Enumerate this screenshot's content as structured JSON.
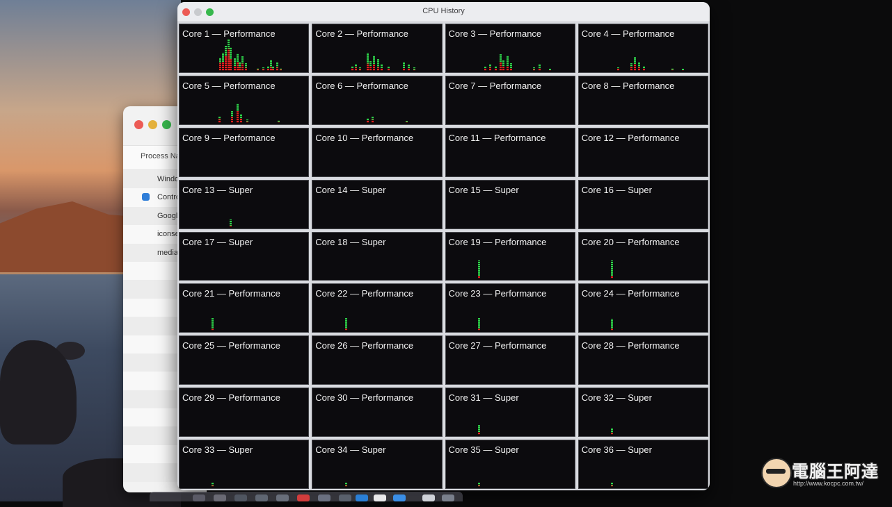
{
  "cpu_window": {
    "title": "CPU History",
    "cores": [
      {
        "label": "Core 1 — Performance",
        "bars": [
          {
            "x": 0.31,
            "h": 0.4,
            "r": 0.6
          },
          {
            "x": 0.33,
            "h": 0.55,
            "r": 0.5
          },
          {
            "x": 0.35,
            "h": 0.75,
            "r": 0.6
          },
          {
            "x": 0.37,
            "h": 0.95,
            "r": 0.7
          },
          {
            "x": 0.39,
            "h": 0.7,
            "r": 0.5
          },
          {
            "x": 0.42,
            "h": 0.38,
            "r": 0.4
          },
          {
            "x": 0.44,
            "h": 0.52,
            "r": 0.5
          },
          {
            "x": 0.46,
            "h": 0.28,
            "r": 0.4
          },
          {
            "x": 0.48,
            "h": 0.44,
            "r": 0.5
          },
          {
            "x": 0.51,
            "h": 0.22,
            "r": 0.4
          },
          {
            "x": 0.6,
            "h": 0.08,
            "r": 0.5
          },
          {
            "x": 0.64,
            "h": 0.1,
            "r": 0.5
          },
          {
            "x": 0.68,
            "h": 0.14,
            "r": 0.4
          },
          {
            "x": 0.7,
            "h": 0.33,
            "r": 0.3
          },
          {
            "x": 0.72,
            "h": 0.12,
            "r": 0.4
          },
          {
            "x": 0.75,
            "h": 0.24,
            "r": 0.4
          },
          {
            "x": 0.78,
            "h": 0.08,
            "r": 0.5
          }
        ]
      },
      {
        "label": "Core 2 — Performance",
        "bars": [
          {
            "x": 0.3,
            "h": 0.14,
            "r": 0.6
          },
          {
            "x": 0.33,
            "h": 0.2,
            "r": 0.5
          },
          {
            "x": 0.36,
            "h": 0.1,
            "r": 0.5
          },
          {
            "x": 0.42,
            "h": 0.55,
            "r": 0.4
          },
          {
            "x": 0.44,
            "h": 0.3,
            "r": 0.5
          },
          {
            "x": 0.47,
            "h": 0.45,
            "r": 0.4
          },
          {
            "x": 0.5,
            "h": 0.35,
            "r": 0.3
          },
          {
            "x": 0.53,
            "h": 0.2,
            "r": 0.4
          },
          {
            "x": 0.58,
            "h": 0.12,
            "r": 0.5
          },
          {
            "x": 0.7,
            "h": 0.25,
            "r": 0.3
          },
          {
            "x": 0.74,
            "h": 0.18,
            "r": 0.4
          },
          {
            "x": 0.78,
            "h": 0.1,
            "r": 0.3
          }
        ]
      },
      {
        "label": "Core 3 — Performance",
        "bars": [
          {
            "x": 0.3,
            "h": 0.12,
            "r": 0.6
          },
          {
            "x": 0.34,
            "h": 0.2,
            "r": 0.5
          },
          {
            "x": 0.38,
            "h": 0.15,
            "r": 0.5
          },
          {
            "x": 0.42,
            "h": 0.5,
            "r": 0.5
          },
          {
            "x": 0.44,
            "h": 0.32,
            "r": 0.4
          },
          {
            "x": 0.47,
            "h": 0.45,
            "r": 0.3
          },
          {
            "x": 0.5,
            "h": 0.22,
            "r": 0.3
          },
          {
            "x": 0.68,
            "h": 0.1,
            "r": 0.4
          },
          {
            "x": 0.72,
            "h": 0.2,
            "r": 0.3
          },
          {
            "x": 0.8,
            "h": 0.06,
            "r": 0.3
          }
        ]
      },
      {
        "label": "Core 4 — Performance",
        "bars": [
          {
            "x": 0.3,
            "h": 0.1,
            "r": 0.6
          },
          {
            "x": 0.4,
            "h": 0.22,
            "r": 0.5
          },
          {
            "x": 0.43,
            "h": 0.42,
            "r": 0.5
          },
          {
            "x": 0.46,
            "h": 0.26,
            "r": 0.4
          },
          {
            "x": 0.5,
            "h": 0.14,
            "r": 0.4
          },
          {
            "x": 0.72,
            "h": 0.08,
            "r": 0.4
          },
          {
            "x": 0.8,
            "h": 0.06,
            "r": 0.3
          }
        ]
      },
      {
        "label": "Core 5 — Performance",
        "bars": [
          {
            "x": 0.3,
            "h": 0.18,
            "r": 0.6
          },
          {
            "x": 0.4,
            "h": 0.35,
            "r": 0.5
          },
          {
            "x": 0.44,
            "h": 0.58,
            "r": 0.6
          },
          {
            "x": 0.47,
            "h": 0.28,
            "r": 0.5
          },
          {
            "x": 0.52,
            "h": 0.1,
            "r": 0.4
          },
          {
            "x": 0.76,
            "h": 0.08,
            "r": 0.4
          }
        ]
      },
      {
        "label": "Core 6 — Performance",
        "bars": [
          {
            "x": 0.42,
            "h": 0.14,
            "r": 0.5
          },
          {
            "x": 0.46,
            "h": 0.18,
            "r": 0.5
          },
          {
            "x": 0.72,
            "h": 0.06,
            "r": 0.5
          }
        ]
      },
      {
        "label": "Core 7 — Performance",
        "bars": []
      },
      {
        "label": "Core 8 — Performance",
        "bars": []
      },
      {
        "label": "Core 9 — Performance",
        "bars": []
      },
      {
        "label": "Core 10 — Performance",
        "bars": []
      },
      {
        "label": "Core 11 — Performance",
        "bars": []
      },
      {
        "label": "Core 12 — Performance",
        "bars": []
      },
      {
        "label": "Core 13 — Super",
        "bars": [
          {
            "x": 0.39,
            "h": 0.22,
            "r": 0.2
          }
        ]
      },
      {
        "label": "Core 14 — Super",
        "bars": []
      },
      {
        "label": "Core 15 — Super",
        "bars": []
      },
      {
        "label": "Core 16 — Super",
        "bars": []
      },
      {
        "label": "Core 17 — Super",
        "bars": []
      },
      {
        "label": "Core 18 — Super",
        "bars": []
      },
      {
        "label": "Core 19 — Performance",
        "bars": [
          {
            "x": 0.25,
            "h": 0.55,
            "r": 0.15
          }
        ]
      },
      {
        "label": "Core 20 — Performance",
        "bars": [
          {
            "x": 0.25,
            "h": 0.55,
            "r": 0.15
          }
        ]
      },
      {
        "label": "Core 21 — Performance",
        "bars": [
          {
            "x": 0.25,
            "h": 0.38,
            "r": 0.15
          }
        ]
      },
      {
        "label": "Core 22 — Performance",
        "bars": [
          {
            "x": 0.25,
            "h": 0.38,
            "r": 0.15
          }
        ]
      },
      {
        "label": "Core 23 — Performance",
        "bars": [
          {
            "x": 0.25,
            "h": 0.38,
            "r": 0.15
          }
        ]
      },
      {
        "label": "Core 24 — Performance",
        "bars": [
          {
            "x": 0.25,
            "h": 0.35,
            "r": 0.15
          }
        ]
      },
      {
        "label": "Core 25 — Performance",
        "bars": []
      },
      {
        "label": "Core 26 — Performance",
        "bars": []
      },
      {
        "label": "Core 27 — Performance",
        "bars": []
      },
      {
        "label": "Core 28 — Performance",
        "bars": []
      },
      {
        "label": "Core 29 — Performance",
        "bars": []
      },
      {
        "label": "Core 30 — Performance",
        "bars": []
      },
      {
        "label": "Core 31 — Super",
        "bars": [
          {
            "x": 0.25,
            "h": 0.3,
            "r": 0.3
          }
        ]
      },
      {
        "label": "Core 32 — Super",
        "bars": [
          {
            "x": 0.25,
            "h": 0.18,
            "r": 0.3
          }
        ]
      },
      {
        "label": "Core 33 — Super",
        "bars": [
          {
            "x": 0.25,
            "h": 0.12,
            "r": 0.3
          }
        ]
      },
      {
        "label": "Core 34 — Super",
        "bars": [
          {
            "x": 0.25,
            "h": 0.12,
            "r": 0.3
          }
        ]
      },
      {
        "label": "Core 35 — Super",
        "bars": [
          {
            "x": 0.25,
            "h": 0.12,
            "r": 0.3
          }
        ]
      },
      {
        "label": "Core 36 — Super",
        "bars": [
          {
            "x": 0.25,
            "h": 0.12,
            "r": 0.3
          }
        ]
      }
    ],
    "colors": {
      "user_load": "#2fcf4a",
      "system_load": "#e02020",
      "background": "#0c0b0e"
    }
  },
  "activity_monitor": {
    "column_header": "Process Na",
    "rows": [
      "Windo",
      "Contro",
      "Googl",
      "iconse",
      "media"
    ]
  },
  "watermark": {
    "title": "電腦王阿達",
    "url": "http://www.kocpc.com.tw/"
  }
}
